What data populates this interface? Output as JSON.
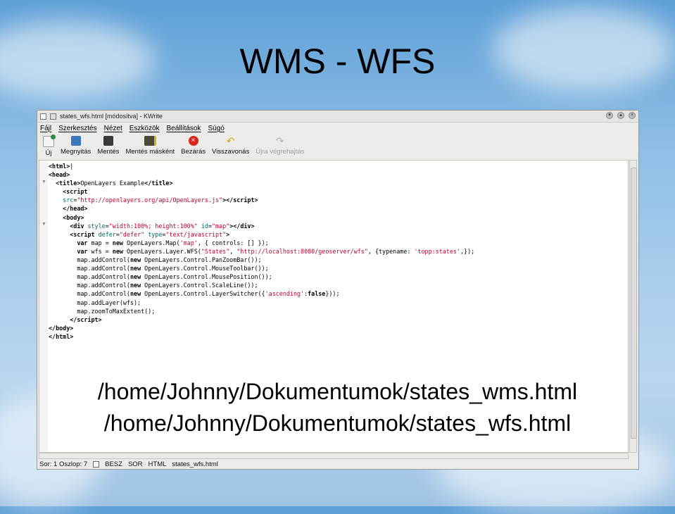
{
  "slide": {
    "title": "WMS - WFS",
    "path_wms": "/home/Johnny/Dokumentumok/states_wms.html",
    "path_wfs": "/home/Johnny/Dokumentumok/states_wfs.html"
  },
  "window": {
    "title": "states_wfs.html [módosítva] - KWrite"
  },
  "menu": [
    "Fájl",
    "Szerkesztés",
    "Nézet",
    "Eszközök",
    "Beállítások",
    "Súgó"
  ],
  "toolbar": [
    {
      "label": "Új",
      "icon": "new-document-icon",
      "color": "#2e8b3d",
      "disabled": false
    },
    {
      "label": "Megnyitás",
      "icon": "open-folder-icon",
      "color": "#3c77c4",
      "disabled": false
    },
    {
      "label": "Mentés",
      "icon": "save-disk-icon",
      "color": "#3a3a3a",
      "disabled": false
    },
    {
      "label": "Mentés másként",
      "icon": "save-as-icon",
      "color": "#4a4a3a",
      "disabled": false
    },
    {
      "label": "Bezárás",
      "icon": "close-document-icon",
      "color": "#d9261c",
      "disabled": false
    },
    {
      "label": "Visszavonás",
      "icon": "undo-icon",
      "color": "#e0a21a",
      "disabled": false
    },
    {
      "label": "Újra végrehajtás",
      "icon": "redo-icon",
      "color": "#b5b5b5",
      "disabled": true
    }
  ],
  "status": {
    "position": "Sor: 1 Oszlop: 7",
    "mode": "BESZ",
    "selection": "SOR",
    "filetype": "HTML",
    "filename": "states_wfs.html"
  }
}
